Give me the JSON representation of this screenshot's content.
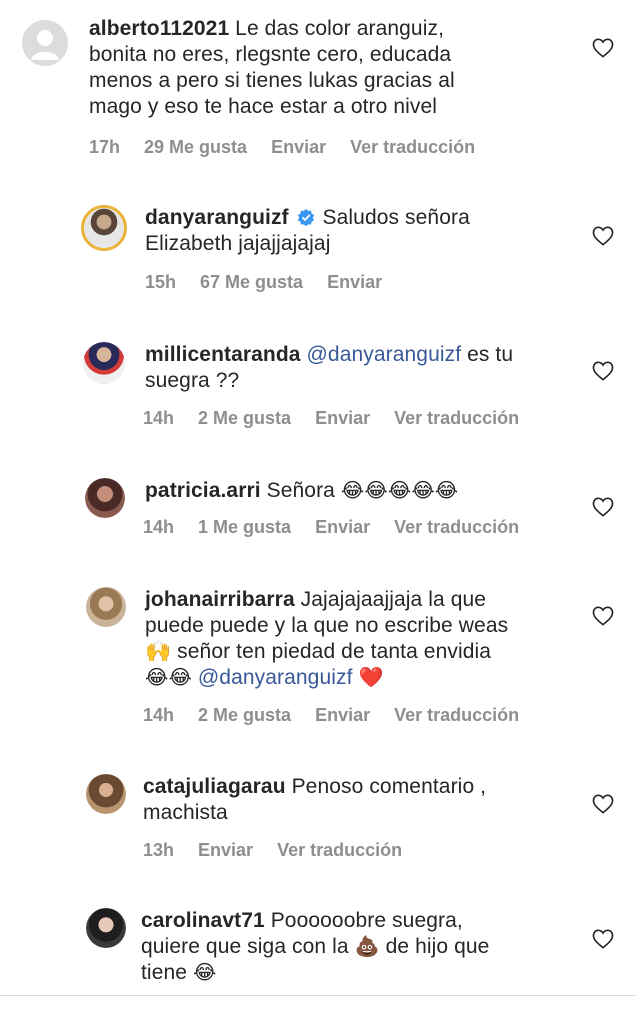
{
  "comments": [
    {
      "username": "alberto112021",
      "lines": [
        "Le das color aranguiz,",
        "bonita no eres, rlegsnte cero, educada",
        "menos a pero si tienes lukas gracias al",
        "mago y eso te hace estar a otro nivel"
      ],
      "time": "17h",
      "likes": "29 Me gusta",
      "reply": "Enviar",
      "translate": "Ver traducción"
    },
    {
      "username": "danyaranguizf",
      "lines": [
        "Saludos señora",
        "Elizabeth jajajjajajaj"
      ],
      "time": "15h",
      "likes": "67 Me gusta",
      "reply": "Enviar"
    },
    {
      "username": "millicentaranda",
      "mention": "@danyaranguizf",
      "lines": [
        "es tu",
        "suegra ??"
      ],
      "time": "14h",
      "likes": "2 Me gusta",
      "reply": "Enviar",
      "translate": "Ver traducción"
    },
    {
      "username": "patricia.arri",
      "lines": [
        "Señora",
        "😂😂😂😂😂"
      ],
      "time": "14h",
      "likes": "1 Me gusta",
      "reply": "Enviar",
      "translate": "Ver traducción"
    },
    {
      "username": "johanairribarra",
      "lines": [
        "Jajajajaajjaja la que",
        "puede puede y la que no escribe weas",
        "🙌 señor ten piedad de tanta envidia",
        "😂😂",
        "@danyaranguizf",
        "❤️"
      ],
      "time": "14h",
      "likes": "2 Me gusta",
      "reply": "Enviar",
      "translate": "Ver traducción"
    },
    {
      "username": "catajuliagarau",
      "lines": [
        "Penoso comentario ,",
        "machista"
      ],
      "time": "13h",
      "reply": "Enviar",
      "translate": "Ver traducción"
    },
    {
      "username": "carolinavt71",
      "lines": [
        "Poooooobre suegra,",
        "quiere que siga con la",
        "💩",
        "de hijo que",
        "tiene",
        "😂"
      ]
    }
  ],
  "colors": {
    "meta": "#8e8e8e",
    "mention": "#385898",
    "verified": "#3897f0"
  }
}
